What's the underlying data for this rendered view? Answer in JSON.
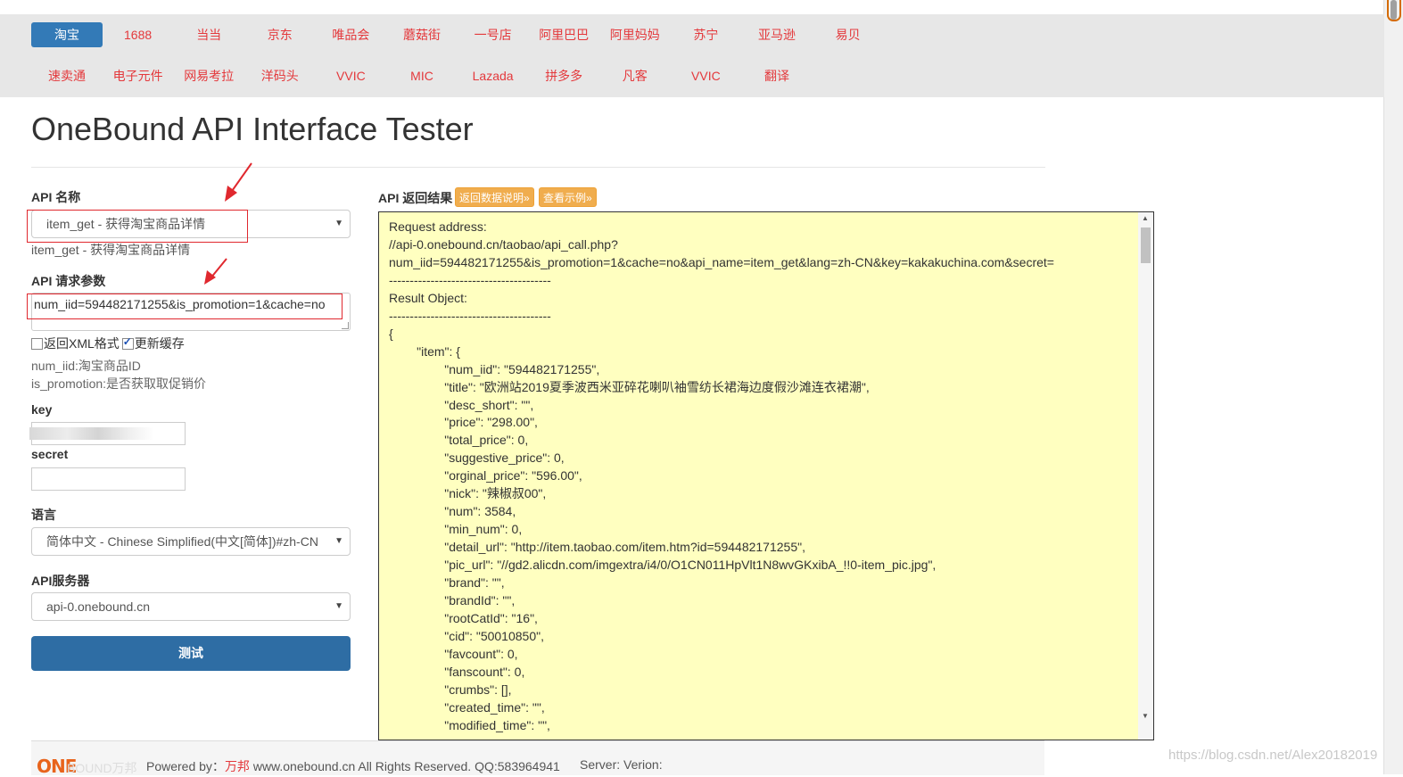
{
  "nav": {
    "row1": [
      "淘宝",
      "1688",
      "当当",
      "京东",
      "唯品会",
      "蘑菇街",
      "一号店",
      "阿里巴巴",
      "阿里妈妈",
      "苏宁",
      "亚马逊",
      "易贝"
    ],
    "row2": [
      "速卖通",
      "电子元件",
      "网易考拉",
      "洋码头",
      "VVIC",
      "MIC",
      "Lazada",
      "拼多多",
      "凡客",
      "VVIC",
      "翻译"
    ],
    "active": "淘宝"
  },
  "page": {
    "title": "OneBound API Interface Tester"
  },
  "form": {
    "api_name_label": "API 名称",
    "api_name_value": "item_get - 获得淘宝商品详情",
    "api_name_helper": "item_get - 获得淘宝商品详情",
    "params_label": "API 请求参数",
    "params_value": "num_iid=594482171255&is_promotion=1&cache=no",
    "xml_label": "返回XML格式",
    "cache_label": "更新缓存",
    "xml_checked": false,
    "cache_checked": true,
    "notes": [
      "num_iid:淘宝商品ID",
      "is_promotion:是否获取取促销价"
    ],
    "key_label": "key",
    "secret_label": "secret",
    "lang_label": "语言",
    "lang_value": "简体中文 - Chinese Simplified(中文[简体])#zh-CN",
    "server_label": "API服务器",
    "server_value": "api-0.onebound.cn",
    "test_button": "测试"
  },
  "result": {
    "label": "API 返回结果",
    "btn_docs": "返回数据说明»",
    "btn_example": "查看示例»",
    "lines": [
      "Request address:",
      "//api-0.onebound.cn/taobao/api_call.php?",
      "num_iid=594482171255&is_promotion=1&cache=no&api_name=item_get&lang=zh-CN&key=kakakuchina.com&secret=",
      "---------------------------------------",
      "Result Object:",
      "---------------------------------------",
      "{",
      "        \"item\": {",
      "                \"num_iid\": \"594482171255\",",
      "                \"title\": \"欧洲站2019夏季波西米亚碎花喇叭袖雪纺长裙海边度假沙滩连衣裙潮\",",
      "                \"desc_short\": \"\",",
      "                \"price\": \"298.00\",",
      "                \"total_price\": 0,",
      "                \"suggestive_price\": 0,",
      "                \"orginal_price\": \"596.00\",",
      "                \"nick\": \"辣椒叔00\",",
      "                \"num\": 3584,",
      "                \"min_num\": 0,",
      "                \"detail_url\": \"http://item.taobao.com/item.htm?id=594482171255\",",
      "                \"pic_url\": \"//gd2.alicdn.com/imgextra/i4/0/O1CN011HpVlt1N8wvGKxibA_!!0-item_pic.jpg\",",
      "                \"brand\": \"\",",
      "                \"brandId\": \"\",",
      "                \"rootCatId\": \"16\",",
      "                \"cid\": \"50010850\",",
      "                \"favcount\": 0,",
      "                \"fanscount\": 0,",
      "                \"crumbs\": [],",
      "                \"created_time\": \"\",",
      "                \"modified_time\": \"\","
    ]
  },
  "footer": {
    "logo": "ONE",
    "logo_faded": "BOUND万邦",
    "powered_prefix": "Powered by：",
    "brand": "万邦",
    "rights": " www.onebound.cn All Rights Reserved. QQ:583964941",
    "server": "Server: Verion:"
  },
  "watermark": "https://blog.csdn.net/Alex20182019"
}
